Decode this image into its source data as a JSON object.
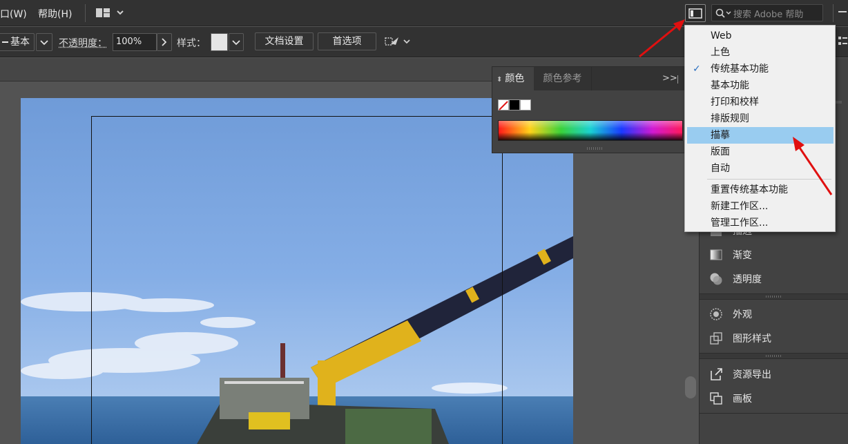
{
  "menubar": {
    "items": [
      "口(W)",
      "帮助(H)"
    ],
    "search_placeholder": "搜索 Adobe 帮助"
  },
  "control": {
    "stroke_label": "基本",
    "opacity_label": "不透明度：",
    "opacity_value": "100%",
    "style_label": "样式：",
    "doc_setup": "文档设置",
    "preferences": "首选项"
  },
  "colorpanel": {
    "tab_color": "颜色",
    "tab_guide": "颜色参考",
    "collapse": ">>"
  },
  "workspace_menu": {
    "items": [
      {
        "label": "Web",
        "checked": false,
        "highlighted": false
      },
      {
        "label": "上色",
        "checked": false,
        "highlighted": false
      },
      {
        "label": "传统基本功能",
        "checked": true,
        "highlighted": false
      },
      {
        "label": "基本功能",
        "checked": false,
        "highlighted": false
      },
      {
        "label": "打印和校样",
        "checked": false,
        "highlighted": false
      },
      {
        "label": "排版规则",
        "checked": false,
        "highlighted": false
      },
      {
        "label": "描摹",
        "checked": false,
        "highlighted": true
      },
      {
        "label": "版面",
        "checked": false,
        "highlighted": false
      },
      {
        "label": "自动",
        "checked": false,
        "highlighted": false
      }
    ],
    "actions": [
      "重置传统基本功能",
      "新建工作区...",
      "管理工作区..."
    ],
    "check_glyph": "✓"
  },
  "dock": {
    "group1": [
      "描边",
      "渐变",
      "透明度"
    ],
    "group2": [
      "外观",
      "图形样式"
    ],
    "group3": [
      "资源导出",
      "画板"
    ]
  },
  "colors": {
    "chrome": "#323232",
    "panel": "#424242",
    "canvas": "#535353",
    "highlight": "#99ccf0",
    "annotation_arrow": "#e01010"
  }
}
